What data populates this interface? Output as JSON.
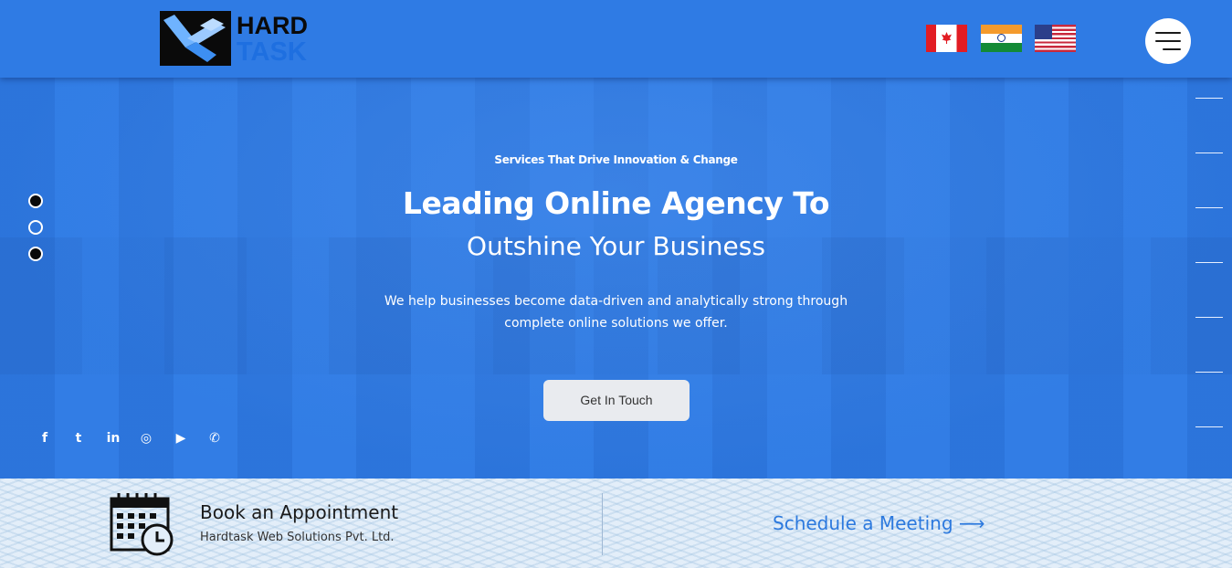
{
  "brand": {
    "logo_top": "HARD",
    "logo_bottom": "TASK"
  },
  "header": {
    "flags": [
      "canada-flag",
      "india-flag",
      "usa-flag"
    ],
    "menu_icon": "hamburger-menu-icon"
  },
  "hero": {
    "eyebrow": "Services That Drive Innovation & Change",
    "headline": "Leading Online Agency To",
    "subhead": "Outshine Your Business",
    "description": "We help businesses become data-driven and analytically strong through complete online solutions we offer.",
    "cta_label": "Get In Touch",
    "slider_dots": 3,
    "active_dot": 2
  },
  "social": {
    "icons": [
      "facebook-icon",
      "twitter-icon",
      "linkedin-icon",
      "instagram-icon",
      "youtube-icon",
      "whatsapp-icon"
    ],
    "glyphs": [
      "f",
      "t",
      "in",
      "◎",
      "▶",
      "✆"
    ]
  },
  "appointment": {
    "title": "Book an Appointment",
    "company": "Hardtask Web Solutions Pvt. Ltd.",
    "schedule_label": "Schedule a Meeting ⟶"
  },
  "colors": {
    "hero_blue": "#2f7be4",
    "band_bg": "#e3eef9",
    "link_blue": "#2c79de"
  }
}
